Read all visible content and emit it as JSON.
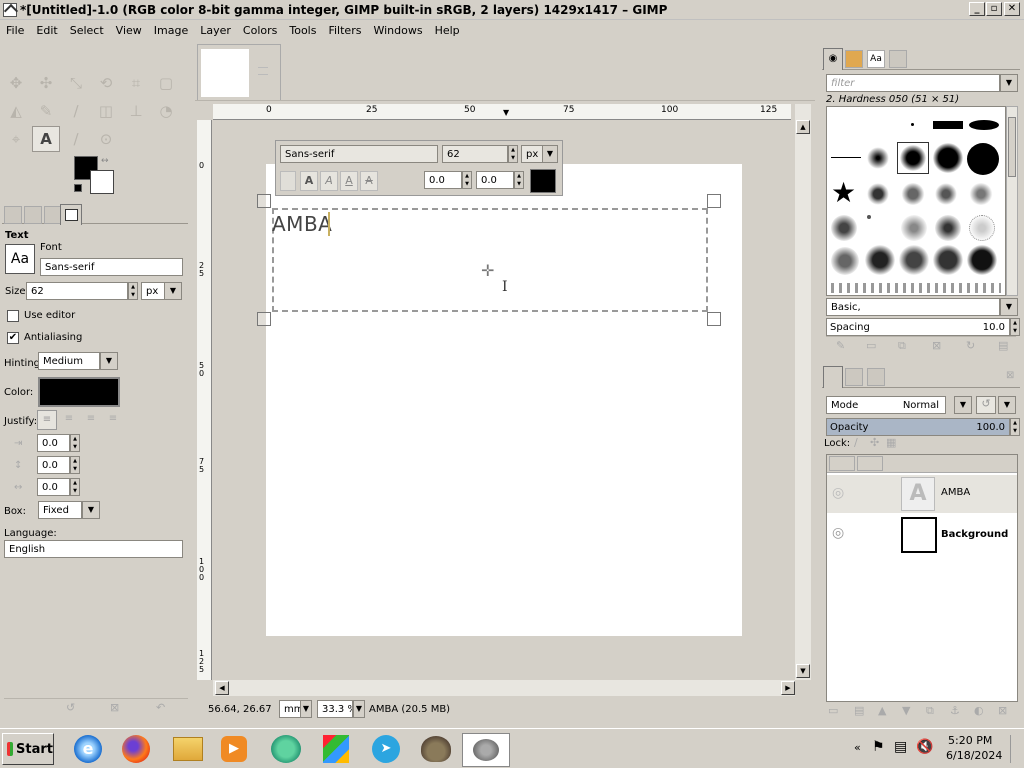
{
  "window": {
    "title": "*[Untitled]-1.0 (RGB color 8-bit gamma integer, GIMP built-in sRGB, 2 layers) 1429x1417 – GIMP",
    "buttons": [
      "_",
      "▫",
      "✕"
    ]
  },
  "menu": [
    "File",
    "Edit",
    "Select",
    "View",
    "Image",
    "Layer",
    "Colors",
    "Tools",
    "Filters",
    "Windows",
    "Help"
  ],
  "colors": {
    "foreground": "#000000",
    "background": "#ffffff",
    "accent_opacity_bar": "#aab6c6"
  },
  "tool_options": {
    "section_title": "Text",
    "font_label": "Font",
    "font_preview": "Aa",
    "font_value": "Sans-serif",
    "size_label": "Size:",
    "size_value": "62",
    "size_unit": "px",
    "use_editor_label": "Use editor",
    "use_editor_checked": false,
    "antialiasing_label": "Antialiasing",
    "antialiasing_checked": true,
    "hinting_label": "Hinting:",
    "hinting_value": "Medium",
    "color_label": "Color:",
    "justify_label": "Justify:",
    "indent_value": "0.0",
    "line_spacing_value": "0.0",
    "letter_spacing_value": "0.0",
    "box_label": "Box:",
    "box_value": "Fixed",
    "language_label": "Language:",
    "language_value": "English"
  },
  "ruler": {
    "h_ticks": [
      "0",
      "25",
      "50",
      "75",
      "100",
      "125"
    ],
    "v_ticks": [
      "0",
      "2\n5",
      "5\n0",
      "7\n5",
      "1\n0\n0",
      "1\n2\n5"
    ]
  },
  "text_toolbar": {
    "font": "Sans-serif",
    "size": "62",
    "unit": "px",
    "baseline": "0.0",
    "kerning": "0.0",
    "style_buttons": [
      "A",
      "A",
      "A",
      "A"
    ]
  },
  "canvas_text": "AMBA",
  "status": {
    "coords": "56.64, 26.67",
    "unit": "mm",
    "zoom": "33.3 %",
    "info": "AMBA (20.5 MB)"
  },
  "brushes": {
    "filter_placeholder": "filter",
    "current_brush": "2. Hardness 050 (51 × 51)",
    "tag_value": "Basic,",
    "spacing_label": "Spacing",
    "spacing_value": "10.0"
  },
  "layers": {
    "mode_label": "Mode",
    "mode_value": "Normal",
    "opacity_label": "Opacity",
    "opacity_value": "100.0",
    "opacity_fraction": 1.0,
    "lock_label": "Lock:",
    "items": [
      {
        "name": "AMBA",
        "thumb": "A"
      },
      {
        "name": "Background",
        "thumb": ""
      }
    ]
  },
  "taskbar": {
    "start_label": "Start",
    "time": "5:20 PM",
    "date": "6/18/2024"
  }
}
